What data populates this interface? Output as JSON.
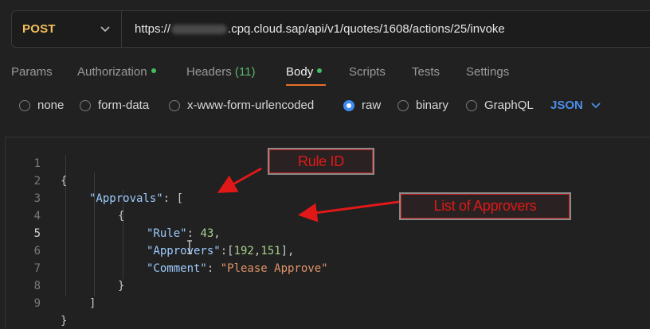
{
  "request": {
    "method": "POST",
    "url_prefix": "https://",
    "url_rest": ".cpq.cloud.sap/api/v1/quotes/1608/actions/25/invoke"
  },
  "tabs": [
    {
      "label": "Params"
    },
    {
      "label": "Authorization"
    },
    {
      "label": "Headers",
      "count": "(11)"
    },
    {
      "label": "Body"
    },
    {
      "label": "Scripts"
    },
    {
      "label": "Tests"
    },
    {
      "label": "Settings"
    }
  ],
  "active_tab": "Body",
  "body_types": [
    "none",
    "form-data",
    "x-www-form-urlencoded",
    "raw",
    "binary",
    "GraphQL"
  ],
  "selected_body_type": "raw",
  "format": "JSON",
  "editor": {
    "line_numbers": [
      "1",
      "2",
      "3",
      "4",
      "5",
      "6",
      "7",
      "8",
      "9"
    ],
    "lines": {
      "l1": "{",
      "l2_key": "\"Approvals\"",
      "l2_punc": ": [",
      "l3": "{",
      "l4_key": "\"Rule\"",
      "l4_colon": ": ",
      "l4_val": "43",
      "l4_comma": ",",
      "l5_key": "\"Approvers\"",
      "l5_open": ":[",
      "l5_v1": "192",
      "l5_sep": ",",
      "l5_v2": "151",
      "l5_close": "],",
      "l6_key": "\"Comment\"",
      "l6_colon": ": ",
      "l6_val": "\"Please Approve\"",
      "l7": "}",
      "l8": "]",
      "l9": "}"
    }
  },
  "annotations": {
    "rule_id": "Rule ID",
    "approvers": "List of Approvers"
  },
  "colors": {
    "method": "#f4c05a",
    "accent_underline": "#e8702a",
    "status_dot": "#3fbf5f",
    "json_key": "#9ecbff",
    "json_number": "#a6d189",
    "json_string": "#e3946b",
    "annotation_red": "#e01818",
    "radio_selected": "#3f8cf0"
  }
}
